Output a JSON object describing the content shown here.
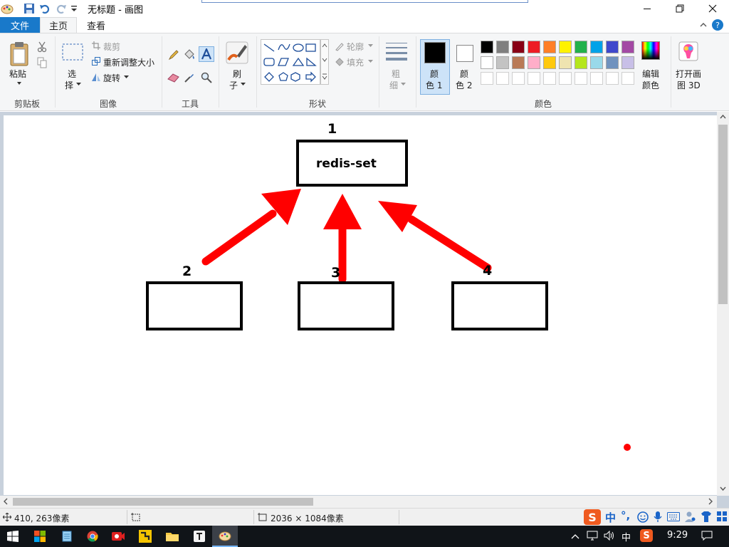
{
  "window": {
    "title": "无标题 - 画图"
  },
  "tabs": {
    "file": "文件",
    "home": "主页",
    "view": "查看"
  },
  "clipboard": {
    "paste": "粘贴",
    "group": "剪贴板"
  },
  "image": {
    "select_1": "选",
    "select_2": "择",
    "crop": "裁剪",
    "resize": "重新调整大小",
    "rotate": "旋转",
    "group": "图像"
  },
  "tools": {
    "group": "工具",
    "brushes_1": "刷",
    "brushes_2": "子"
  },
  "shapes": {
    "outline": "轮廓",
    "fill": "填充",
    "group": "形状"
  },
  "size": {
    "label_1": "粗",
    "label_2": "细"
  },
  "colors": {
    "color1_1": "颜",
    "color1_2": "色 1",
    "color2_1": "颜",
    "color2_2": "色 2",
    "edit_1": "编辑",
    "edit_2": "颜色",
    "paint3d_1": "打开画",
    "paint3d_2": "图 3D",
    "group": "颜色",
    "color1_value": "#000000",
    "color2_value": "#ffffff",
    "palette_row1": [
      "#000000",
      "#7f7f7f",
      "#880015",
      "#ed1c24",
      "#ff7f27",
      "#fff200",
      "#22b14c",
      "#00a2e8",
      "#3f48cc",
      "#a349a4"
    ],
    "palette_row2": [
      "#ffffff",
      "#c3c3c3",
      "#b97a57",
      "#ffaec9",
      "#ffc90e",
      "#efe4b0",
      "#b5e61d",
      "#99d9ea",
      "#7092be",
      "#c8bfe7"
    ]
  },
  "canvas": {
    "box_main_label": "redis-set",
    "num_1": "1",
    "num_2": "2",
    "num_3": "3",
    "num_4": "4",
    "arrow_color": "#ff0000"
  },
  "status": {
    "cursor_pos": "410, 263像素",
    "canvas_size": "2036 × 1084像素"
  },
  "taskbar": {
    "ime_lang": "中",
    "ime_punct": "°,",
    "tray_lang": "中",
    "clock": "9:29"
  }
}
